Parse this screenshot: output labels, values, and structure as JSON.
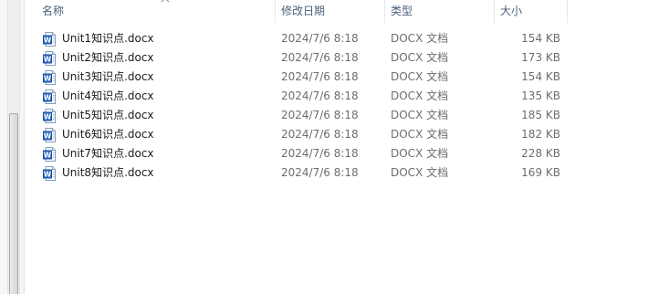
{
  "columns": {
    "name": "名称",
    "date": "修改日期",
    "type": "类型",
    "size": "大小"
  },
  "files": [
    {
      "name": "Unit1知识点.docx",
      "date": "2024/7/6 8:18",
      "type": "DOCX 文档",
      "size": "154 KB",
      "icon": "word-doc-icon"
    },
    {
      "name": "Unit2知识点.docx",
      "date": "2024/7/6 8:18",
      "type": "DOCX 文档",
      "size": "173 KB",
      "icon": "word-doc-icon"
    },
    {
      "name": "Unit3知识点.docx",
      "date": "2024/7/6 8:18",
      "type": "DOCX 文档",
      "size": "154 KB",
      "icon": "word-doc-icon"
    },
    {
      "name": "Unit4知识点.docx",
      "date": "2024/7/6 8:18",
      "type": "DOCX 文档",
      "size": "135 KB",
      "icon": "word-doc-icon"
    },
    {
      "name": "Unit5知识点.docx",
      "date": "2024/7/6 8:18",
      "type": "DOCX 文档",
      "size": "185 KB",
      "icon": "word-doc-icon"
    },
    {
      "name": "Unit6知识点.docx",
      "date": "2024/7/6 8:18",
      "type": "DOCX 文档",
      "size": "182 KB",
      "icon": "word-doc-icon"
    },
    {
      "name": "Unit7知识点.docx",
      "date": "2024/7/6 8:18",
      "type": "DOCX 文档",
      "size": "228 KB",
      "icon": "word-doc-icon"
    },
    {
      "name": "Unit8知识点.docx",
      "date": "2024/7/6 8:18",
      "type": "DOCX 文档",
      "size": "169 KB",
      "icon": "word-doc-icon"
    }
  ],
  "colors": {
    "header_text": "#4c607a",
    "secondary_text": "#6d6d6d",
    "word_icon_blue": "#2b6cc4"
  }
}
